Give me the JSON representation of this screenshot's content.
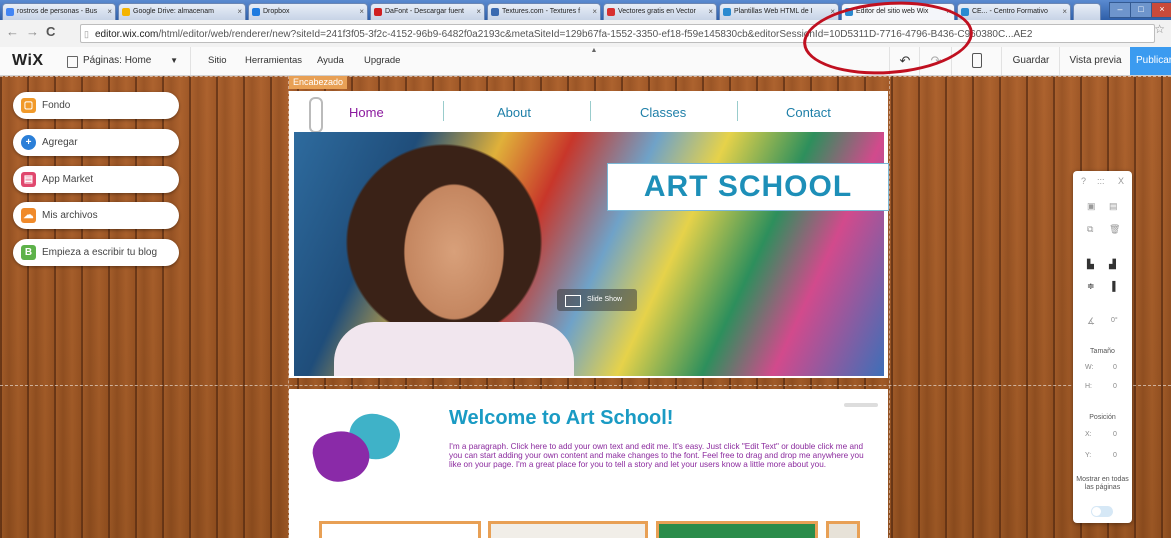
{
  "browser": {
    "tabs": [
      {
        "label": "rostros de personas - Bus",
        "color": "#4285f4"
      },
      {
        "label": "Google Drive: almacenam",
        "color": "#f4b400"
      },
      {
        "label": "Dropbox",
        "color": "#1e7be0"
      },
      {
        "label": "DaFont - Descargar fuent",
        "color": "#d02020"
      },
      {
        "label": "Textures.com - Textures f",
        "color": "#3a6ab0"
      },
      {
        "label": "Vectores gratis en Vector",
        "color": "#d83030"
      },
      {
        "label": "Plantillas Web HTML de I",
        "color": "#2a8ad0"
      },
      {
        "label": "Editor del sitio web Wix",
        "color": "#2a8ad0"
      },
      {
        "label": "CE... - Centro Formativo",
        "color": "#2a8ad0"
      }
    ],
    "url_host": "editor.wix.com",
    "url_path": "/html/editor/web/renderer/new?siteId=241f3f05-3f2c-4152-96b9-6482f0a2193c&metaSiteId=129b67fa-1552-3350-ef18-f59e145830cb&editorSessionId=10D5311D-7716-4796-B436-C960380C...AE2"
  },
  "wix": {
    "logo": "WiX",
    "pages_label": "Páginas: Home",
    "menu": [
      "Sitio",
      "Herramientas",
      "Ayuda",
      "Upgrade"
    ],
    "save": "Guardar",
    "preview": "Vista previa",
    "publish": "Publicar"
  },
  "left_panel": [
    {
      "label": "Fondo",
      "icon": "background-icon",
      "color": "#f19a2a",
      "glyph": "▢"
    },
    {
      "label": "Agregar",
      "icon": "add-icon",
      "color": "#2b7fd8",
      "glyph": "+"
    },
    {
      "label": "App Market",
      "icon": "app-market-icon",
      "color": "#e0486e",
      "glyph": "▤"
    },
    {
      "label": "Mis archivos",
      "icon": "my-files-icon",
      "color": "#f08a2a",
      "glyph": "☁"
    },
    {
      "label": "Empieza a escribir tu blog",
      "icon": "blog-icon",
      "color": "#5db24a",
      "glyph": "B"
    }
  ],
  "site": {
    "header_tag": "Encabezado",
    "nav": [
      "Home",
      "About",
      "Classes",
      "Contact"
    ],
    "title_part1": "ART SCH",
    "title_part2": "OOL",
    "slideshow": "Slide Show",
    "welcome": "Welcome to Art School!",
    "paragraph": "I'm a paragraph. Click here to add your own text and edit me. It's easy. Just click \"Edit Text\" or double click me and you can start adding your own content and make changes to the font. Feel free to drag and drop me anywhere you like on your page. I'm a great place for you to tell a story and let your users know a little more about you."
  },
  "right_panel": {
    "top": "?",
    "drag": ":::",
    "close": "X",
    "angle_value": "0°",
    "size_label": "Tamaño",
    "w_label": "W:",
    "w_value": "0",
    "h_label": "H:",
    "h_value": "0",
    "position_label": "Posición",
    "x_label": "X:",
    "x_value": "0",
    "y_label": "Y:",
    "y_value": "0",
    "show_all": "Mostrar en todas las páginas"
  }
}
